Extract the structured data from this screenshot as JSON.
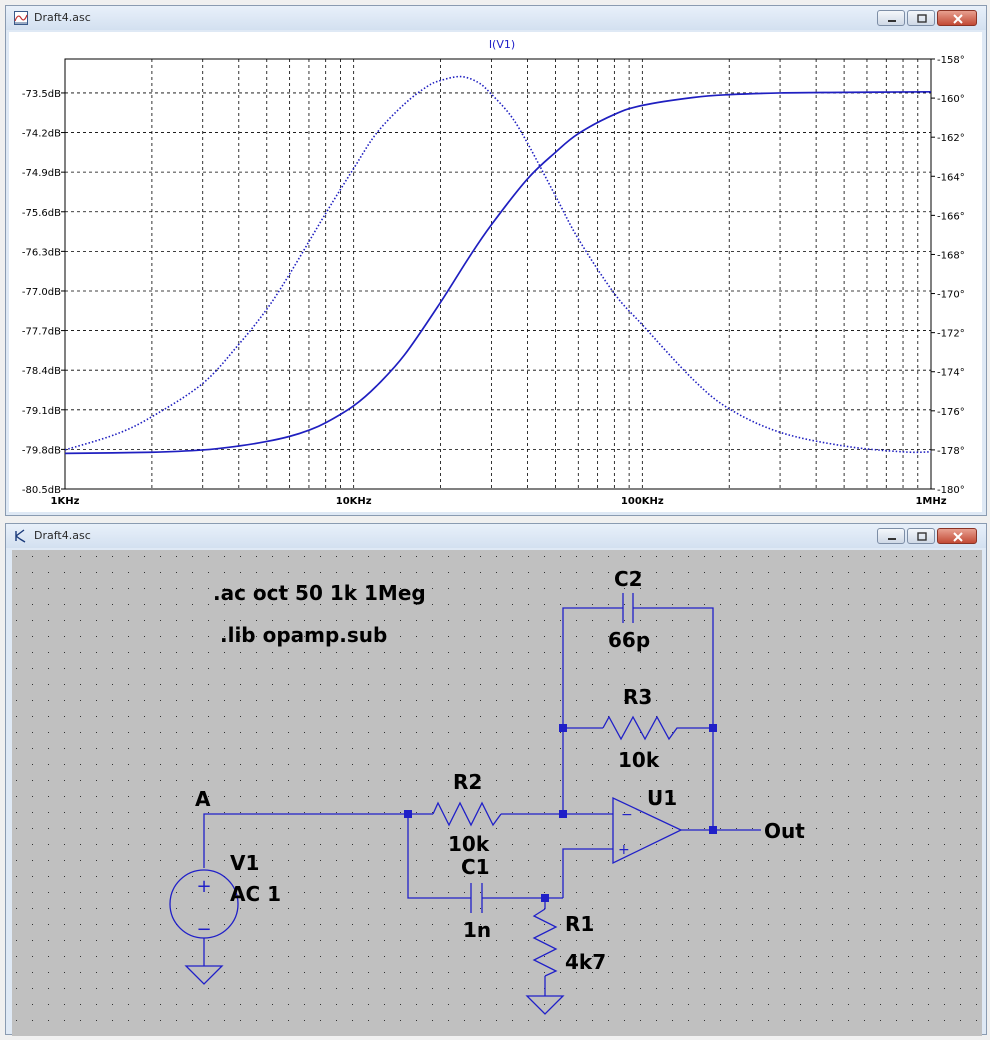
{
  "plot_window": {
    "title": "Draft4.asc",
    "trace_name": "I(V1)"
  },
  "schematic_window": {
    "title": "Draft4.asc",
    "directives": [
      ".ac oct 50 1k 1Meg",
      ".lib opamp.sub"
    ],
    "components": {
      "c2": {
        "name": "C2",
        "value": "66p"
      },
      "r3": {
        "name": "R3",
        "value": "10k"
      },
      "r2": {
        "name": "R2",
        "value": "10k"
      },
      "c1": {
        "name": "C1",
        "value": "1n"
      },
      "r1": {
        "name": "R1",
        "value": "4k7"
      },
      "v1": {
        "name": "V1",
        "value": "AC 1"
      },
      "u1": {
        "name": "U1"
      }
    },
    "net_labels": {
      "a": "A",
      "out": "Out"
    },
    "opamp_pins": {
      "minus": "−",
      "plus": "+"
    },
    "source_symbols": {
      "plus": "+",
      "minus": "−"
    }
  },
  "chart_data": {
    "type": "line",
    "title": "I(V1)",
    "x_scale": "log",
    "xlim": [
      1000,
      1000000
    ],
    "x_tick_labels": [
      "1KHz",
      "10KHz",
      "100KHz",
      "1MHz"
    ],
    "y_left_ticks": [
      "-73.5dB",
      "-74.2dB",
      "-74.9dB",
      "-75.6dB",
      "-76.3dB",
      "-77.0dB",
      "-77.7dB",
      "-78.4dB",
      "-79.1dB",
      "-79.8dB",
      "-80.5dB"
    ],
    "y_right_ticks": [
      "-158°",
      "-160°",
      "-162°",
      "-164°",
      "-166°",
      "-168°",
      "-170°",
      "-172°",
      "-174°",
      "-176°",
      "-178°",
      "-180°"
    ],
    "ylim_left": [
      -80.5,
      -72.9
    ],
    "ylim_right": [
      -180,
      -158
    ],
    "grid": true,
    "series": [
      {
        "style": "solid",
        "axis": "left",
        "x": [
          1000,
          2000,
          3000,
          4000,
          5000,
          6000,
          7000,
          8000,
          10000,
          12000,
          15000,
          20000,
          25000,
          30000,
          40000,
          50000,
          60000,
          80000,
          100000,
          150000,
          200000,
          300000,
          500000,
          1000000
        ],
        "y": [
          -79.87,
          -79.85,
          -79.81,
          -79.74,
          -79.66,
          -79.57,
          -79.46,
          -79.33,
          -79.03,
          -78.68,
          -78.13,
          -77.2,
          -76.42,
          -75.83,
          -75.02,
          -74.55,
          -74.22,
          -73.88,
          -73.72,
          -73.58,
          -73.53,
          -73.5,
          -73.49,
          -73.48
        ]
      },
      {
        "style": "dotted",
        "axis": "right",
        "x": [
          1000,
          1500,
          2000,
          3000,
          4000,
          5000,
          6000,
          8000,
          10000,
          12000,
          15000,
          18000,
          20000,
          23500,
          27000,
          30000,
          35000,
          40000,
          50000,
          60000,
          80000,
          100000,
          150000,
          200000,
          300000,
          500000,
          800000,
          1000000
        ],
        "y": [
          -178.0,
          -177.2,
          -176.3,
          -174.6,
          -172.6,
          -170.8,
          -169.0,
          -165.9,
          -163.6,
          -161.8,
          -160.3,
          -159.4,
          -159.1,
          -158.9,
          -159.2,
          -159.8,
          -160.9,
          -162.3,
          -165.0,
          -167.2,
          -170.0,
          -171.6,
          -174.4,
          -175.9,
          -177.1,
          -177.8,
          -178.1,
          -178.1
        ]
      }
    ]
  }
}
